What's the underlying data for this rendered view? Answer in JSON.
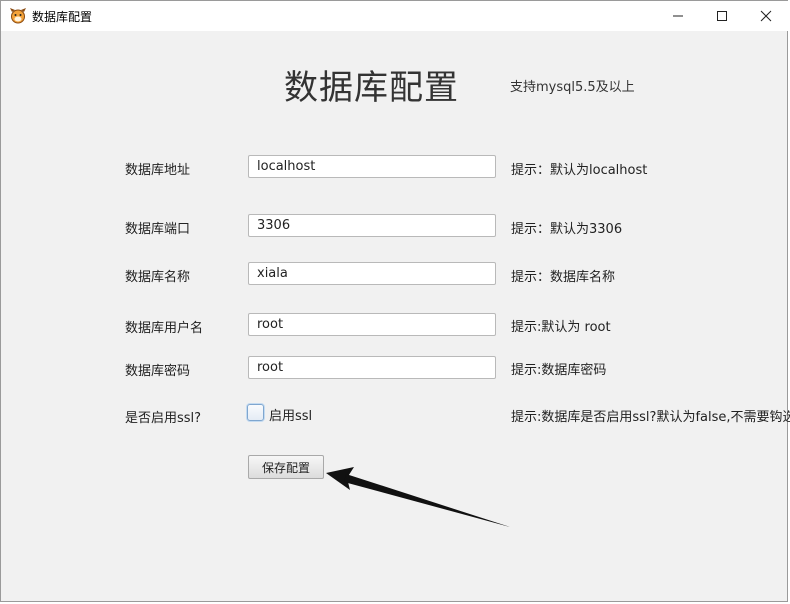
{
  "window": {
    "title": "数据库配置"
  },
  "page": {
    "heading": "数据库配置",
    "subheading": "支持mysql5.5及以上"
  },
  "form": {
    "fields": [
      {
        "label": "数据库地址",
        "value": "localhost",
        "hint": "提示：默认为localhost"
      },
      {
        "label": "数据库端口",
        "value": "3306",
        "hint": "提示：默认为3306"
      },
      {
        "label": "数据库名称",
        "value": "xiala",
        "hint": "提示：数据库名称"
      },
      {
        "label": "数据库用户名",
        "value": "root",
        "hint": "提示:默认为 root"
      },
      {
        "label": "数据库密码",
        "value": "root",
        "hint": "提示:数据库密码"
      }
    ],
    "ssl": {
      "label": "是否启用ssl?",
      "checkbox_label": "启用ssl",
      "checked": false,
      "hint": "提示:数据库是否启用ssl?默认为false,不需要钩选"
    },
    "save_label": "保存配置"
  },
  "colors": {
    "window_bg": "#f1f1f1",
    "titlebar_bg": "#ffffff",
    "arrow": "#111111"
  }
}
